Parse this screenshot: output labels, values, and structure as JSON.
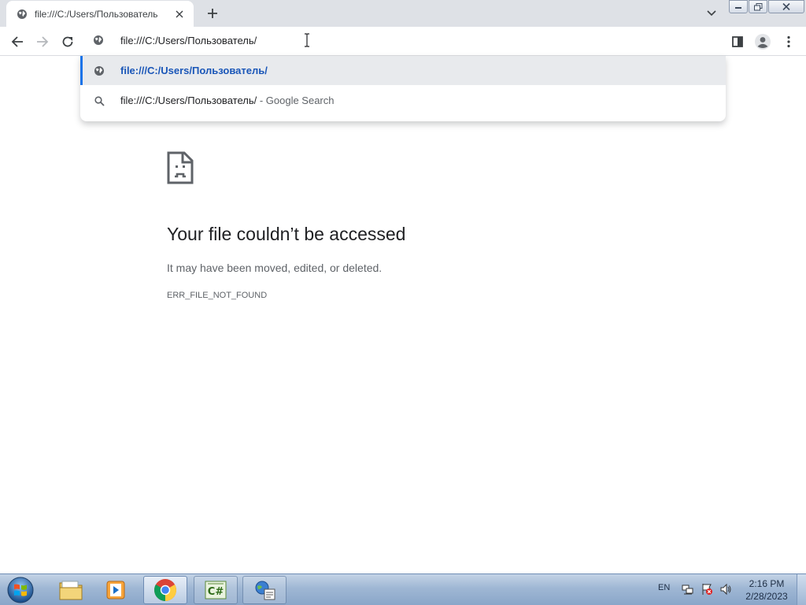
{
  "tab": {
    "title": "file:///C:/Users/Пользователь",
    "favicon": "globe-icon"
  },
  "window_controls": [
    "minimize-icon",
    "restore-icon",
    "close-icon"
  ],
  "toolbar": {
    "back": "back-arrow-icon",
    "forward": "forward-arrow-icon",
    "reload": "reload-icon",
    "side_panel": "side-panel-icon",
    "profile": "profile-icon",
    "menu": "kebab-menu-icon"
  },
  "omnibox": {
    "value": "file:///C:/Users/Пользователь/"
  },
  "suggestions": [
    {
      "text": "file:///C:/Users/Пользователь/",
      "suffix": "",
      "icon": "globe-icon",
      "selected": true
    },
    {
      "text": "file:///C:/Users/Пользователь/",
      "suffix": " - Google Search",
      "icon": "search-icon",
      "selected": false
    }
  ],
  "error": {
    "icon": "sad-file-icon",
    "title": "Your file couldn’t be accessed",
    "description": "It may have been moved, edited, or deleted.",
    "code": "ERR_FILE_NOT_FOUND"
  },
  "taskbar": {
    "apps": [
      "file-explorer-icon",
      "media-player-icon",
      "chrome-icon",
      "csharp-ide-icon",
      "network-tool-icon"
    ],
    "active_app": "chrome-icon",
    "language": "EN",
    "time": "2:16 PM",
    "date": "2/28/2023"
  },
  "colors": {
    "accent": "#1a73e8",
    "tabstrip": "#dee1e6",
    "selected_row": "#e8eaed"
  }
}
